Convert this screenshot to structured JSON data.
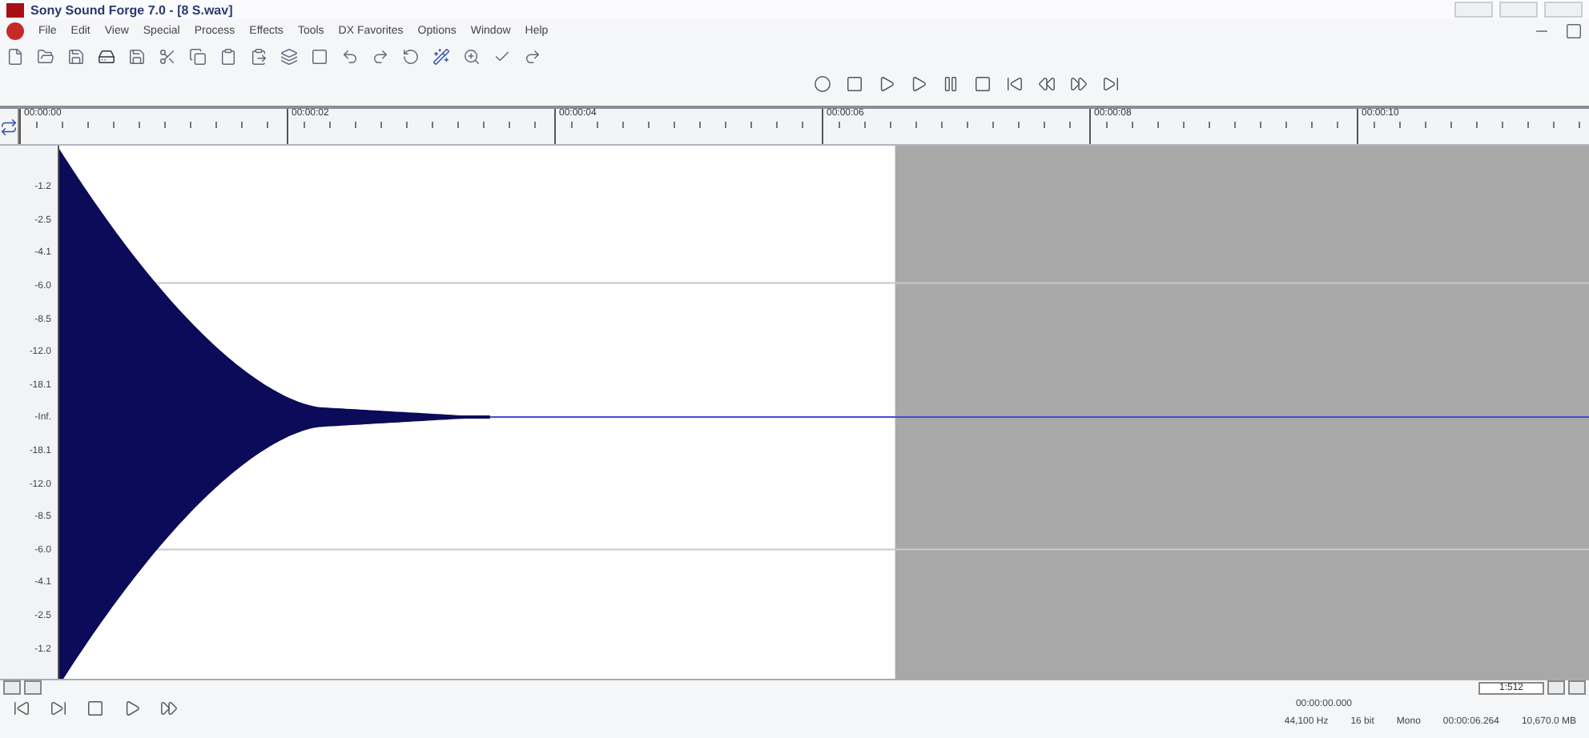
{
  "window": {
    "title": "Sony Sound Forge 7.0 - [8 S.wav]"
  },
  "menu": [
    "File",
    "Edit",
    "View",
    "Special",
    "Process",
    "Effects",
    "Tools",
    "DX Favorites",
    "Options",
    "Window",
    "Help"
  ],
  "ruler": {
    "labels": [
      "00:00:00",
      "00:00:02",
      "00:00:04",
      "00:00:06",
      "00:00:08",
      "00:00:10"
    ]
  },
  "scale": {
    "labels": [
      "-1.2",
      "-2.5",
      "-4.1",
      "-6.0",
      "-8.5",
      "-12.0",
      "-18.1",
      "-Inf.",
      "-18.1",
      "-12.0",
      "-8.5",
      "-6.0",
      "-4.1",
      "-2.5",
      "-1.2"
    ]
  },
  "zoom_ratio": "1:512",
  "status": {
    "position": "00:00:00.000",
    "fields": [
      "44,100 Hz",
      "16 bit",
      "Mono",
      "00:00:06.264",
      "10,670.0 MB"
    ]
  }
}
